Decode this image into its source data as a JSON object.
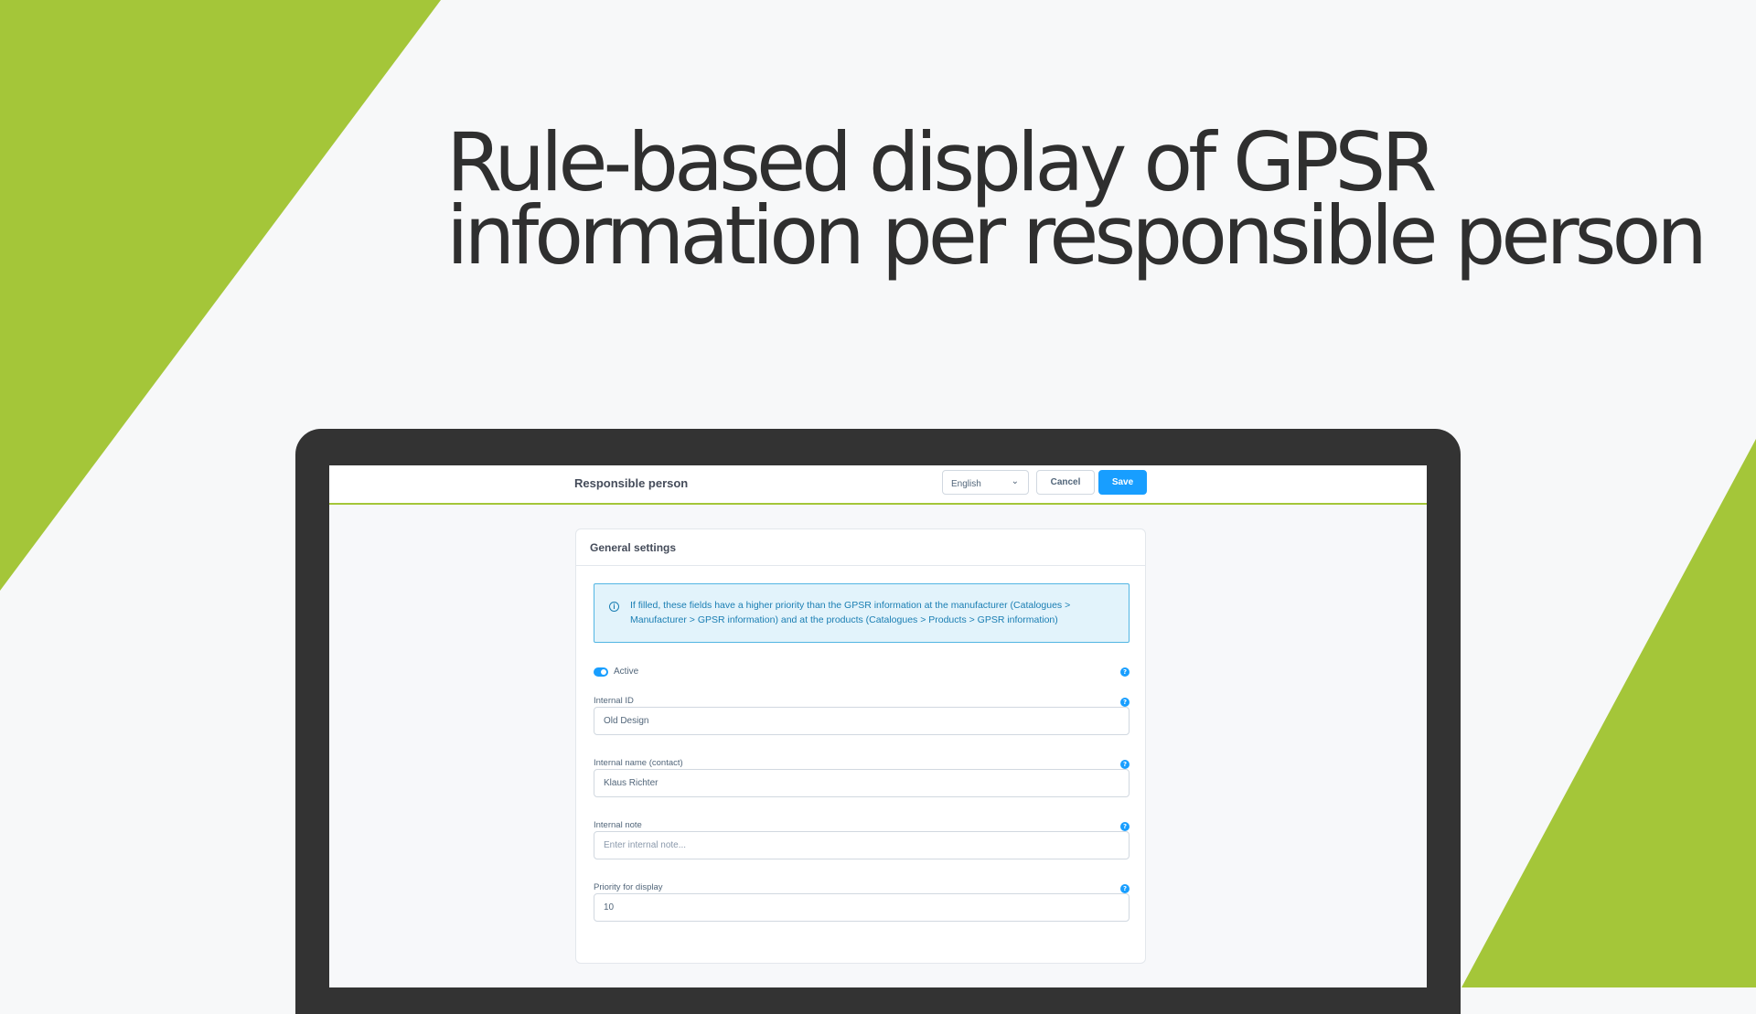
{
  "headline": {
    "line1": "Rule-based display of GPSR",
    "line2": "information per responsible person"
  },
  "colors": {
    "accent_green": "#a4c639",
    "primary_blue": "#189eff",
    "monitor_frame": "#333333",
    "alert_text": "#1a7eb3"
  },
  "app": {
    "page_title": "Responsible person",
    "language_select": {
      "value": "English",
      "icon": "chevron-down-icon"
    },
    "cancel_label": "Cancel",
    "save_label": "Save"
  },
  "card": {
    "title": "General settings",
    "alert": {
      "icon": "info-icon",
      "text": "If filled, these fields have a higher priority than the GPSR information at the manufacturer (Catalogues > Manufacturer > GPSR information) and at the products (Catalogues > Products > GPSR information)"
    },
    "active_toggle": {
      "label": "Active",
      "checked": true
    },
    "fields": [
      {
        "label": "Internal ID",
        "value": "Old Design",
        "placeholder": ""
      },
      {
        "label": "Internal name (contact)",
        "value": "Klaus Richter",
        "placeholder": ""
      },
      {
        "label": "Internal note",
        "value": "",
        "placeholder": "Enter internal note..."
      },
      {
        "label": "Priority for display",
        "value": "10",
        "placeholder": ""
      }
    ],
    "help_icon": "question-icon"
  }
}
